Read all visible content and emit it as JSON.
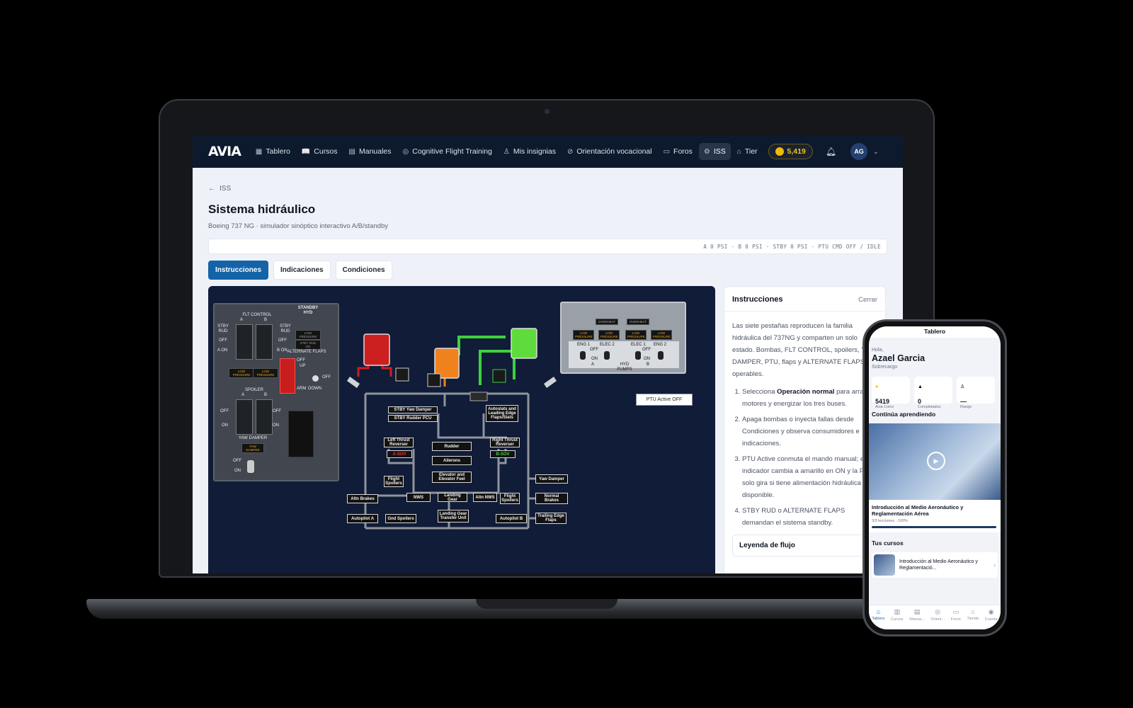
{
  "nav": {
    "logo": "AVIA",
    "items": [
      {
        "label": "Tablero",
        "icon": "grid-icon"
      },
      {
        "label": "Cursos",
        "icon": "book-icon"
      },
      {
        "label": "Manuales",
        "icon": "document-icon"
      },
      {
        "label": "Cognitive Flight Training",
        "icon": "brain-icon"
      },
      {
        "label": "Mis insignias",
        "icon": "badge-icon"
      },
      {
        "label": "Orientación vocacional",
        "icon": "compass-icon"
      },
      {
        "label": "Foros",
        "icon": "chat-icon"
      },
      {
        "label": "ISS",
        "icon": "wrench-icon",
        "active": true
      },
      {
        "label": "Tier",
        "icon": "store-icon"
      }
    ],
    "coins": "5,419",
    "avatar": "AG"
  },
  "page": {
    "back": "ISS",
    "title": "Sistema hidráulico",
    "subtitle": "Boeing 737 NG · simulador sinóptico interactivo A/B/standby",
    "status": "A 0 PSI · B 0 PSI · STBY 0 PSI · PTU CMD OFF / IDLE",
    "tabs": [
      "Instrucciones",
      "Indicaciones",
      "Condiciones"
    ]
  },
  "diagram": {
    "flt_panel": {
      "flt_control": "FLT CONTROL",
      "a": "A",
      "b": "B",
      "stby_rud": "STBY RUD",
      "off": "OFF",
      "a_on": "A ON",
      "b_on": "B ON",
      "standby_hyd": "STANDBY HYD",
      "low_pressure": "LOW PRESSURE",
      "stby_rud_on": "STBY RUD ON",
      "alternate_flaps": "ALTERNATE FLAPS",
      "arm": "ARM",
      "up": "UP",
      "down": "DOWN",
      "spoiler": "SPOILER",
      "on": "ON",
      "yaw_damper_label": "YAW DAMPER",
      "yaw_damper_light": "YAW DAMPER"
    },
    "pump_panel": {
      "overheat": "OVERHEAT",
      "low_pressure": "LOW PRESSURE",
      "eng1": "ENG 1",
      "elec2": "ELEC 2",
      "elec1": "ELEC 1",
      "eng2": "ENG 2",
      "off": "OFF",
      "on": "ON",
      "a": "A",
      "b": "B",
      "hyd_pumps": "HYD PUMPS"
    },
    "nodes": {
      "stby_yaw_damper": "STBY Yaw Damper",
      "stby_rudder_pcu": "STBY Rudder PCU",
      "autoslats": "Autoslats and Leading Edge Flaps/Slats",
      "left_thrust_reverser": "Left Thrust Reverser",
      "right_thrust_reverser": "Right Thrust Reverser",
      "rudder": "Rudder",
      "ailerons": "Ailerons",
      "elevator": "Elevator and Elevator Feel",
      "a_sov": "A-SOV",
      "b_sov": "B-SOV",
      "flight_spoilers_l": "Flight Spoilers",
      "flight_spoilers_r": "Flight Spoilers",
      "yaw_damper": "Yaw Damper",
      "altn_brakes": "Altn Brakes",
      "nws": "NWS",
      "landing_gear": "Landing Gear",
      "altn_nws": "Altn NWS",
      "normal_brakes": "Normal Brakes",
      "autopilot_a": "Autopilot A",
      "gnd_spoilers": "Gnd Spoilers",
      "ldg_gear_transfer": "Landing Gear Transfer Unit",
      "autopilot_b": "Autopilot B",
      "trailing_edge": "Trailing Edge Flaps"
    },
    "ptu_status": "PTU Active OFF",
    "colors": {
      "system_a": "#cc1f1f",
      "standby": "#f0821e",
      "system_b": "#3ed13e",
      "idle_line": "#8f949c"
    }
  },
  "sidebar": {
    "title": "Instrucciones",
    "close": "Cerrar",
    "intro": "Las siete pestañas reproducen la familia hidráulica del 737NG y comparten un solo estado. Bombas, FLT CONTROL, spoilers, YAW DAMPER, PTU, flaps y ALTERNATE FLAPS son operables.",
    "step1_pre": "Selecciona ",
    "step1_bold": "Operación normal",
    "step1_post": " para arrancar motores y energizar los tres buses.",
    "step2": "Apaga bombas o inyecta fallas desde Condiciones y observa consumidores e indicaciones.",
    "step3": "PTU Active conmuta el mando manual; el indicador cambia a amarillo en ON y la PTU solo gira si tiene alimentación hidráulica disponible.",
    "step4": "STBY RUD o ALTERNATE FLAPS demandan el sistema standby.",
    "legend": "Leyenda de flujo"
  },
  "phone": {
    "top": "Tablero",
    "greet": "Hola,",
    "name": "Azael Garcia",
    "role": "Sobrecargo",
    "stats": [
      {
        "value": "5419",
        "label": "Avia Coins",
        "icon": "coin-icon"
      },
      {
        "value": "0",
        "label": "Completados",
        "icon": "cap-icon"
      },
      {
        "value": "—",
        "label": "Rango",
        "icon": "medal-icon"
      }
    ],
    "continue": "Continúa aprendiendo",
    "card_title": "Introducción al Medio Aeronáutico y Reglamentación Aérea",
    "card_sub": "3/3 lecciones · 100%",
    "card_progress": 1.0,
    "courses": "Tus cursos",
    "course_title": "Introducción al Medio Aeronáutico y Reglamentació...",
    "tabbar": [
      "Tablero",
      "Cursos",
      "Manua...",
      "Orient...",
      "Foros",
      "Tienda",
      "Cuenta"
    ]
  }
}
